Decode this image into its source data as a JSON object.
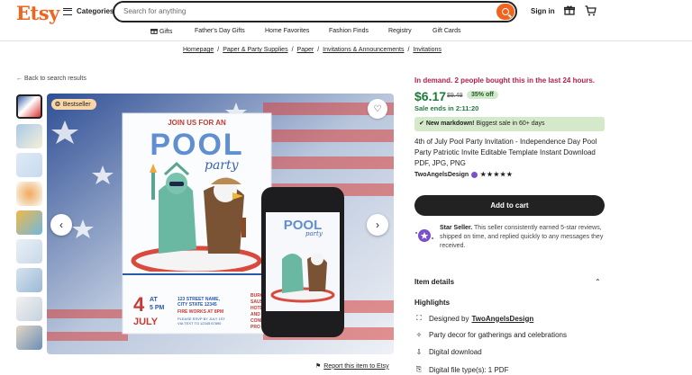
{
  "header": {
    "logo": "Etsy",
    "categories_label": "Categories",
    "search_placeholder": "Search for anything",
    "sign_in": "Sign in"
  },
  "nav": [
    "Gifts",
    "Father's Day Gifts",
    "Home Favorites",
    "Fashion Finds",
    "Registry",
    "Gift Cards"
  ],
  "breadcrumbs": [
    "Homepage",
    "Paper & Party Supplies",
    "Paper",
    "Invitations & Announcements",
    "Invitations"
  ],
  "back_link": "Back to search results",
  "gallery": {
    "badge": "Bestseller",
    "report": "Report this item to Etsy",
    "image": {
      "top_text": "JOIN US FOR AN",
      "headline": "POOL",
      "script": "party",
      "date_num": "4",
      "date_at": "AT",
      "date_time": "5 PM",
      "date_month": "JULY",
      "address": "123 STREET NAME, CITY STATE 12345",
      "fireworks": "FIRE WORKS AT 8PM",
      "rsvp": "PLEASE RSVP BY JULY 1ST VIA TEXT TO 12345 67890",
      "side_text": "BURG SAUSA HOTDOG, AND CONDIM PRO",
      "phone_headline": "POOL",
      "phone_script": "party"
    }
  },
  "product": {
    "demand": "In demand. 2 people bought this in the last 24 hours.",
    "price": "$6.17",
    "old_price": "$9.49",
    "discount": "35% off",
    "sale_ends": "Sale ends in 2:11:20",
    "markdown_label": "New markdown!",
    "markdown_text": "Biggest sale in 60+ days",
    "title": "4th of July Pool Party Invitation - Independence Day Pool Party Patriotic Invite Editable Template Instant Download PDF, JPG, PNG",
    "shop_name": "TwoAngelsDesign",
    "stars": "★★★★★",
    "add_to_cart": "Add to cart",
    "star_seller_title": "Star Seller.",
    "star_seller_text": "This seller consistently earned 5-star reviews, shipped on time, and replied quickly to any messages they received.",
    "item_details": "Item details",
    "highlights": "Highlights",
    "designed_by_prefix": "Designed by",
    "designed_by": "TwoAngelsDesign",
    "party_decor": "Party decor for gatherings and celebrations",
    "digital_download": "Digital download",
    "file_types": "Digital file type(s): 1 PDF"
  },
  "colors": {
    "brand": "#f1641e",
    "demand": "#b3214d",
    "price": "#1d7a3a",
    "markdown_bg": "#d4e9c9"
  }
}
